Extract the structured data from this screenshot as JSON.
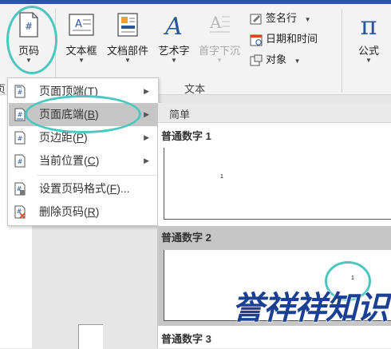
{
  "ribbon": {
    "page_number": {
      "label": "页码"
    },
    "text_box": {
      "label": "文本框"
    },
    "doc_parts": {
      "label": "文档部件"
    },
    "wordart": {
      "label": "艺术字"
    },
    "dropcap": {
      "label": "首字下沉"
    },
    "signature": {
      "label": "签名行"
    },
    "datetime": {
      "label": "日期和时间"
    },
    "object": {
      "label": "对象"
    },
    "equation": {
      "label": "公式"
    },
    "group_text": "文本",
    "left_edge_char": "页"
  },
  "menu": {
    "items": [
      {
        "label": "页面顶端(T)",
        "display": "页面顶端(",
        "key": "T",
        "tail": ")",
        "submenu": true
      },
      {
        "label": "页面底端(B)",
        "display": "页面底端(",
        "key": "B",
        "tail": ")",
        "submenu": true,
        "highlighted": true
      },
      {
        "label": "页边距(P)",
        "display": "页边距(",
        "key": "P",
        "tail": ")",
        "submenu": true
      },
      {
        "label": "当前位置(C)",
        "display": "当前位置(",
        "key": "C",
        "tail": ")",
        "submenu": true
      },
      {
        "label": "设置页码格式(F)...",
        "display": "设置页码格式(",
        "key": "F",
        "tail": ")...",
        "submenu": false
      },
      {
        "label": "删除页码(R)",
        "display": "删除页码(",
        "key": "R",
        "tail": ")",
        "submenu": false
      }
    ]
  },
  "gallery": {
    "section": "简单",
    "items": [
      {
        "title": "普通数字 1",
        "number": "1"
      },
      {
        "title": "普通数字 2",
        "number": "1"
      },
      {
        "title": "普通数字 3"
      }
    ]
  },
  "watermark": {
    "text": "誉祥祥知识"
  },
  "colors": {
    "accent": "#2b579a",
    "circle": "#4cc7c0",
    "watermark": "#1b3f93"
  }
}
